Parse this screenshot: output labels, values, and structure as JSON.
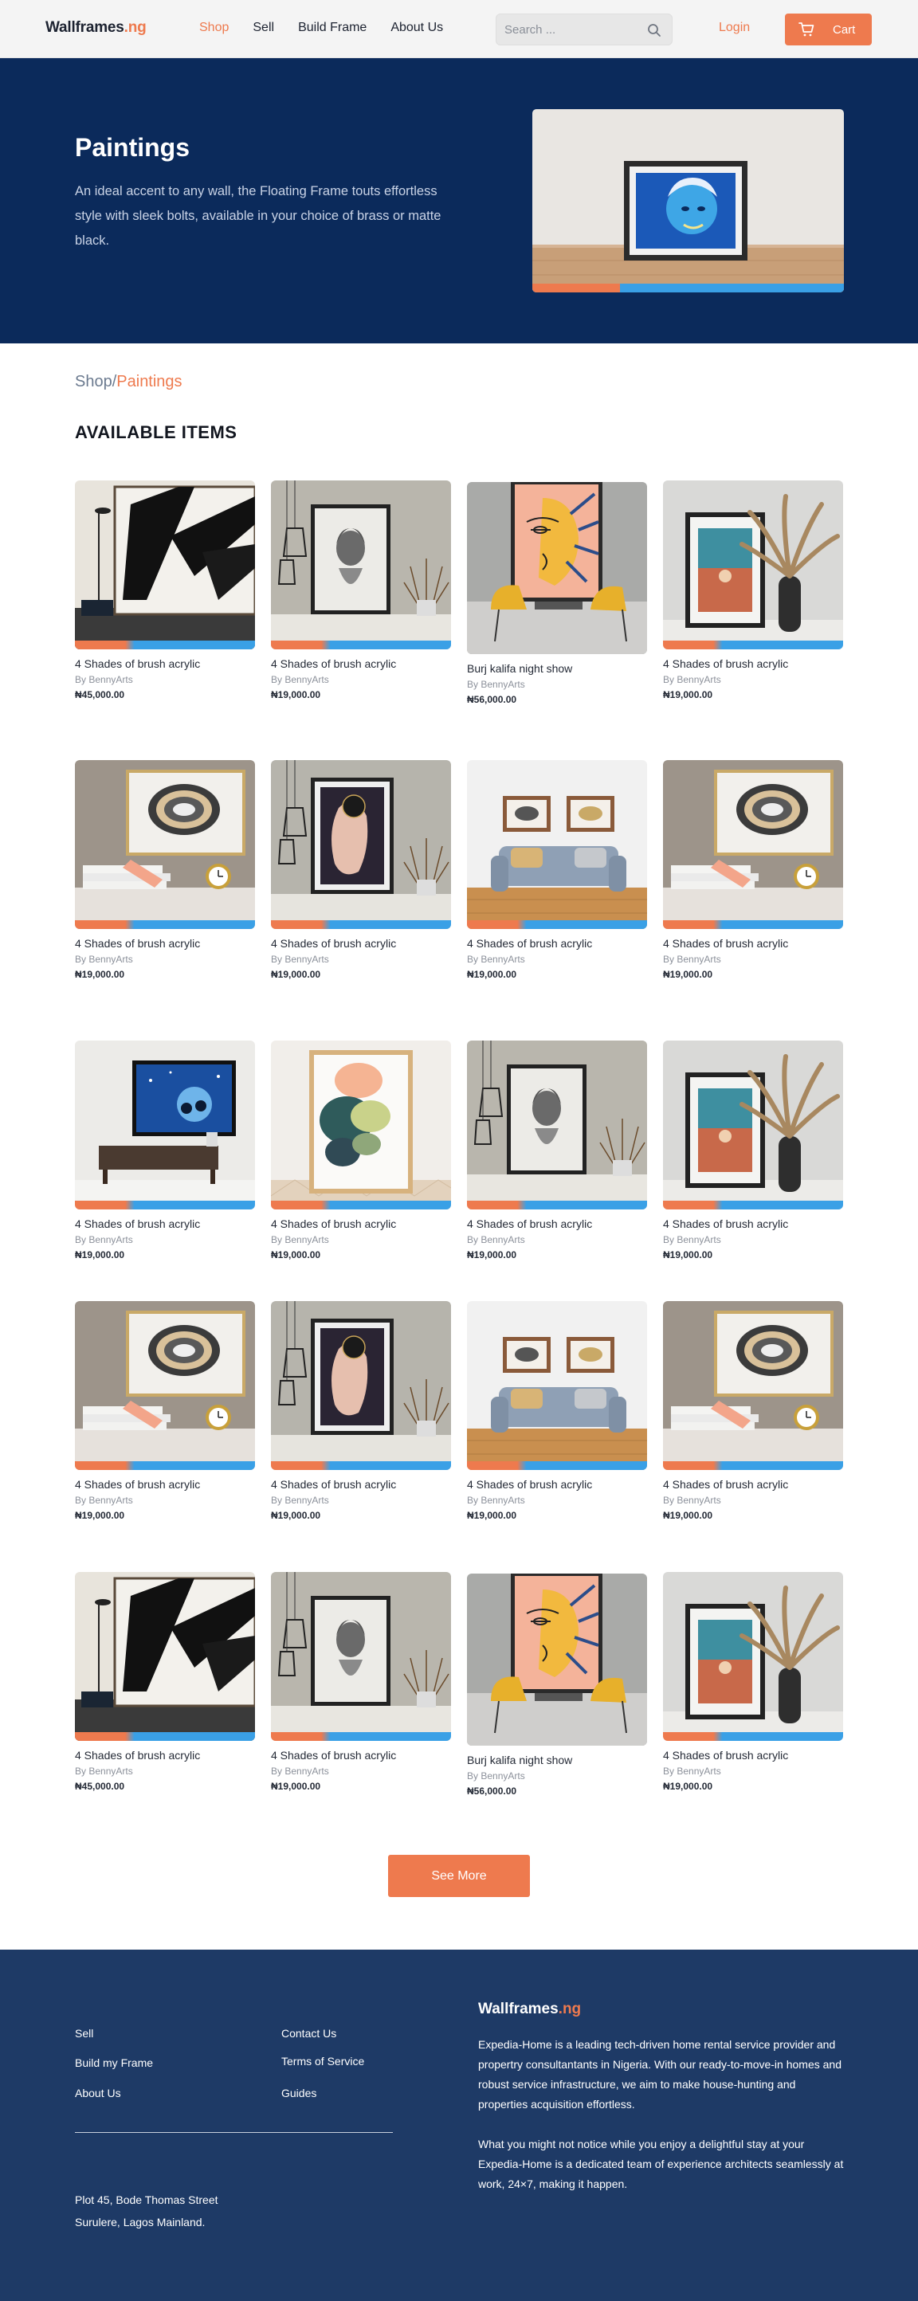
{
  "nav": {
    "logo_main": "Wallframes",
    "logo_accent": ".ng",
    "links": [
      "Shop",
      "Sell",
      "Build Frame",
      "About Us"
    ],
    "search_placeholder": "Search ...",
    "login": "Login",
    "cart": "Cart"
  },
  "hero": {
    "title": "Paintings",
    "description": "An ideal accent to any wall, the Floating Frame touts effortless style with sleek bolts, available in your choice of brass or matte black."
  },
  "breadcrumb": {
    "root": "Shop",
    "sep": "/",
    "current": "Paintings"
  },
  "section_title": "AVAILABLE ITEMS",
  "products": [
    {
      "name": "4 Shades of brush acrylic",
      "by": "By BennyArts",
      "price": "₦45,000.00",
      "art": "abstract"
    },
    {
      "name": "4 Shades of brush acrylic",
      "by": "By BennyArts",
      "price": "₦19,000.00",
      "art": "lady"
    },
    {
      "name": "Burj kalifa night show",
      "by": "By BennyArts",
      "price": "₦56,000.00",
      "art": "face"
    },
    {
      "name": "4 Shades of brush acrylic",
      "by": "By BennyArts",
      "price": "₦19,000.00",
      "art": "pampas"
    },
    {
      "name": "4 Shades of brush acrylic",
      "by": "By BennyArts",
      "price": "₦19,000.00",
      "art": "agate"
    },
    {
      "name": "4 Shades of brush acrylic",
      "by": "By BennyArts",
      "price": "₦19,000.00",
      "art": "dark"
    },
    {
      "name": "4 Shades of brush acrylic",
      "by": "By BennyArts",
      "price": "₦19,000.00",
      "art": "sofa"
    },
    {
      "name": "4 Shades of brush acrylic",
      "by": "By BennyArts",
      "price": "₦19,000.00",
      "art": "agate"
    },
    {
      "name": "4 Shades of brush acrylic",
      "by": "By BennyArts",
      "price": "₦19,000.00",
      "art": "night"
    },
    {
      "name": "4 Shades of brush acrylic",
      "by": "By BennyArts",
      "price": "₦19,000.00",
      "art": "splash"
    },
    {
      "name": "4 Shades of brush acrylic",
      "by": "By BennyArts",
      "price": "₦19,000.00",
      "art": "lady"
    },
    {
      "name": "4 Shades of brush acrylic",
      "by": "By BennyArts",
      "price": "₦19,000.00",
      "art": "pampas"
    },
    {
      "name": "4 Shades of brush acrylic",
      "by": "By BennyArts",
      "price": "₦19,000.00",
      "art": "agate"
    },
    {
      "name": "4 Shades of brush acrylic",
      "by": "By BennyArts",
      "price": "₦19,000.00",
      "art": "dark"
    },
    {
      "name": "4 Shades of brush acrylic",
      "by": "By BennyArts",
      "price": "₦19,000.00",
      "art": "sofa"
    },
    {
      "name": "4 Shades of brush acrylic",
      "by": "By BennyArts",
      "price": "₦19,000.00",
      "art": "agate"
    },
    {
      "name": "4 Shades of brush acrylic",
      "by": "By BennyArts",
      "price": "₦45,000.00",
      "art": "abstract"
    },
    {
      "name": "4 Shades of brush acrylic",
      "by": "By BennyArts",
      "price": "₦19,000.00",
      "art": "lady"
    },
    {
      "name": "Burj kalifa night show",
      "by": "By BennyArts",
      "price": "₦56,000.00",
      "art": "face"
    },
    {
      "name": "4 Shades of brush acrylic",
      "by": "By BennyArts",
      "price": "₦19,000.00",
      "art": "pampas"
    }
  ],
  "see_more": "See More",
  "footer": {
    "col1": [
      "Sell",
      "Build my Frame",
      "About Us"
    ],
    "col2": [
      "Contact Us",
      "Terms of Service",
      "Guides"
    ],
    "address_line1": "Plot 45, Bode Thomas Street",
    "address_line2": "Surulere, Lagos Mainland.",
    "logo_main": "Wallframes",
    "logo_accent": ".ng",
    "para1": "Expedia-Home is a leading tech-driven home rental service provider and propertry consultantants in Nigeria. With our ready-to-move-in homes and robust service infrastructure, we aim to make house-hunting and properties acquisition effortless.",
    "para2": "What you might not notice while you enjoy a delightful stay at your Expedia-Home is a dedicated team of experience architects seamlessly at work, 24×7, making it happen."
  },
  "colors": {
    "accent": "#ee7a4e",
    "hero_bg": "#0b2a5b",
    "footer_bg": "#1e3a66"
  }
}
